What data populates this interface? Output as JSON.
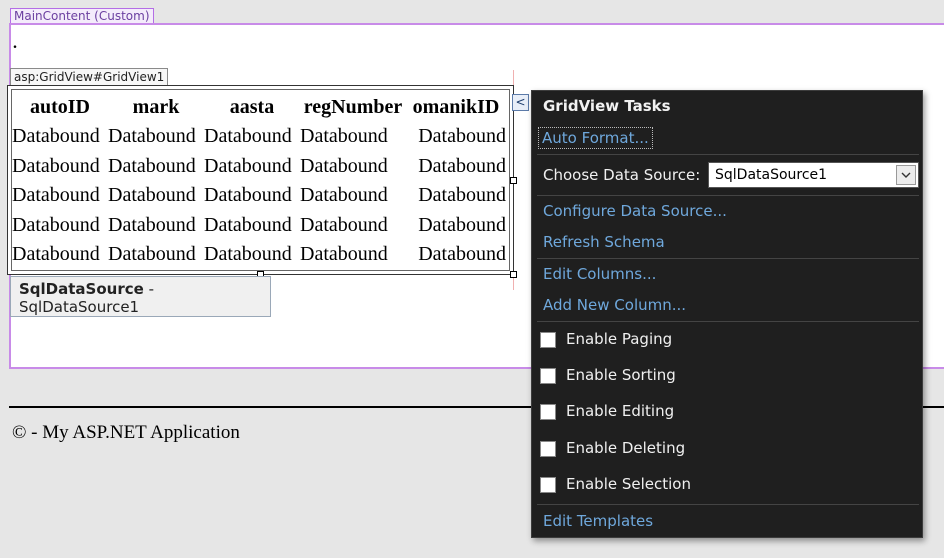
{
  "main_content_tag": "MainContent (Custom)",
  "dot": ".",
  "grid_tag": "asp:GridView#GridView1",
  "grid": {
    "columns": [
      "autoID",
      "mark",
      "aasta",
      "regNumber",
      "omanikID"
    ],
    "rows": [
      [
        "Databound",
        "Databound",
        "Databound",
        "Databound",
        "Databound"
      ],
      [
        "Databound",
        "Databound",
        "Databound",
        "Databound",
        "Databound"
      ],
      [
        "Databound",
        "Databound",
        "Databound",
        "Databound",
        "Databound"
      ],
      [
        "Databound",
        "Databound",
        "Databound",
        "Databound",
        "Databound"
      ],
      [
        "Databound",
        "Databound",
        "Databound",
        "Databound",
        "Databound"
      ]
    ]
  },
  "smart_tag_glyph": "<",
  "sql_datasource": {
    "type": "SqlDataSource",
    "separator": " - ",
    "id": "SqlDataSource1"
  },
  "footer": "© - My ASP.NET Application",
  "tasks": {
    "title": "GridView Tasks",
    "auto_format": "Auto Format...",
    "choose_ds_label": "Choose Data Source:",
    "choose_ds_value": "SqlDataSource1",
    "configure_ds": "Configure Data Source...",
    "refresh_schema": "Refresh Schema",
    "edit_columns": "Edit Columns...",
    "add_new_column": "Add New Column...",
    "enable_paging": "Enable Paging",
    "enable_sorting": "Enable Sorting",
    "enable_editing": "Enable Editing",
    "enable_deleting": "Enable Deleting",
    "enable_selection": "Enable Selection",
    "edit_templates": "Edit Templates",
    "paging_checked": false,
    "sorting_checked": false,
    "editing_checked": false,
    "deleting_checked": false,
    "selection_checked": false
  },
  "colors": {
    "panel_bg": "#1f1f1f",
    "link": "#6fa8dc",
    "main_border": "#c88be8"
  },
  "icons": {
    "dropdown_arrow": "chevron-down-icon",
    "smart_tag": "chevron-left-icon"
  }
}
